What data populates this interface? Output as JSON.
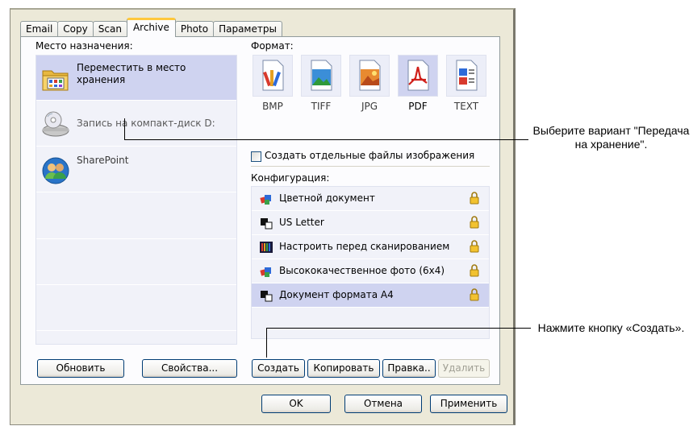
{
  "tabs": [
    "Email",
    "Copy",
    "Scan",
    "Archive",
    "Photo",
    "Параметры"
  ],
  "active_tab": "Archive",
  "destination": {
    "label": "Место назначения:",
    "items": [
      {
        "label": "Переместить в место хранения",
        "icon": "folder-icon",
        "selected": true
      },
      {
        "label": "Запись на компакт-диск  D:",
        "icon": "cd-drive-icon",
        "selected": false
      },
      {
        "label": "SharePoint",
        "icon": "sharepoint-icon",
        "selected": false
      }
    ],
    "refresh_button": "Обновить",
    "properties_button": "Свойства..."
  },
  "format": {
    "label": "Формат:",
    "items": [
      {
        "name": "BMP",
        "icon": "bmp-file-icon"
      },
      {
        "name": "TIFF",
        "icon": "tiff-file-icon"
      },
      {
        "name": "JPG",
        "icon": "jpg-file-icon"
      },
      {
        "name": "PDF",
        "icon": "pdf-file-icon",
        "selected": true
      },
      {
        "name": "TEXT",
        "icon": "text-file-icon"
      }
    ],
    "separate_files_checkbox": "Создать отдельные файлы изображения",
    "separate_files_checked": false
  },
  "configuration": {
    "label": "Конфигурация:",
    "items": [
      {
        "label": "Цветной документ",
        "icon": "color-document-icon"
      },
      {
        "label": "US Letter",
        "icon": "bw-document-icon"
      },
      {
        "label": "Настроить перед сканированием",
        "icon": "configure-icon"
      },
      {
        "label": "Высококачественное фото (6x4)",
        "icon": "color-document-icon"
      },
      {
        "label": "Документ формата A4",
        "icon": "bw-document-icon",
        "selected": true
      }
    ],
    "buttons": {
      "create": "Создать",
      "copy": "Копировать",
      "edit": "Правка..",
      "delete": "Удалить"
    }
  },
  "dialog_buttons": {
    "ok": "OK",
    "cancel": "Отмена",
    "apply": "Применить"
  },
  "callouts": {
    "top": "Выберите вариант \"Передача на хранение\".",
    "bottom": "Нажмите кнопку «Создать»."
  }
}
